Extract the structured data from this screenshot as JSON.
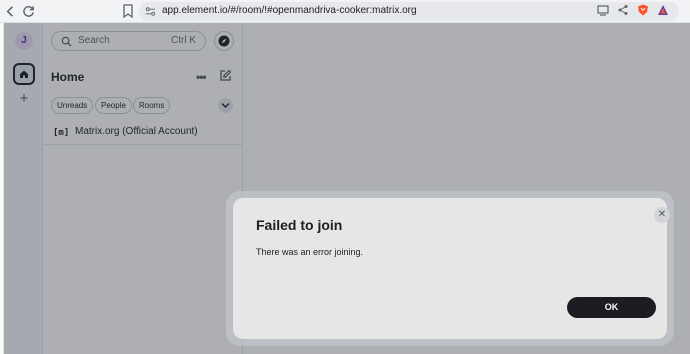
{
  "browser": {
    "url": "app.element.io/#/room/!#openmandriva-cooker:matrix.org"
  },
  "spaces": {
    "avatar_letter": "J",
    "add_label": "+"
  },
  "room_list": {
    "search_placeholder": "Search",
    "search_shortcut": "Ctrl K",
    "title": "Home",
    "more_label": "•••",
    "filters": [
      "Unreads",
      "People",
      "Rooms"
    ],
    "rooms": [
      {
        "icon_text": "[m]",
        "name": "Matrix.org (Official Account)"
      }
    ]
  },
  "dialog": {
    "title": "Failed to join",
    "message": "There was an error joining.",
    "ok_label": "OK",
    "close_glyph": "✕"
  },
  "colors": {
    "accent": "#1b1d22",
    "avatar_bg": "#e9dbf9",
    "brave_orange": "#fb542b"
  }
}
